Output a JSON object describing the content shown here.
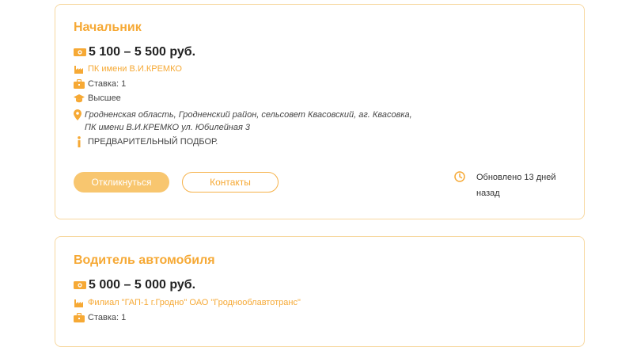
{
  "cards": [
    {
      "title": "Начальник",
      "salary": "5 100 – 5 500 руб.",
      "organization": "ПК имени В.И.КРЕМКО",
      "rate": "Ставка: 1",
      "education": "Высшее",
      "address": "Гродненская область, Гродненский район, сельсовет Квасовский, аг. Квасовка, ПК имени В.И.КРЕМКО ул. Юбилейная 3",
      "note": "ПРЕДВАРИТЕЛЬНЫЙ ПОДБОР.",
      "apply_label": "Откликнуться",
      "contacts_label": "Контакты",
      "updated": "Обновлено 13 дней назад"
    },
    {
      "title": "Водитель автомобиля",
      "salary": "5 000 – 5 000 руб.",
      "organization": "Филиал \"ГАП-1 г.Гродно\" ОАО \"Гроднооблавтотранс\"",
      "rate": "Ставка: 1"
    }
  ],
  "colors": {
    "accent": "#f6a935",
    "button_fill": "#f8c66f",
    "border": "#f7d8a0"
  },
  "icons": [
    "money-icon",
    "factory-icon",
    "briefcase-icon",
    "graduation-cap-icon",
    "location-pin-icon",
    "info-icon",
    "clock-icon"
  ]
}
